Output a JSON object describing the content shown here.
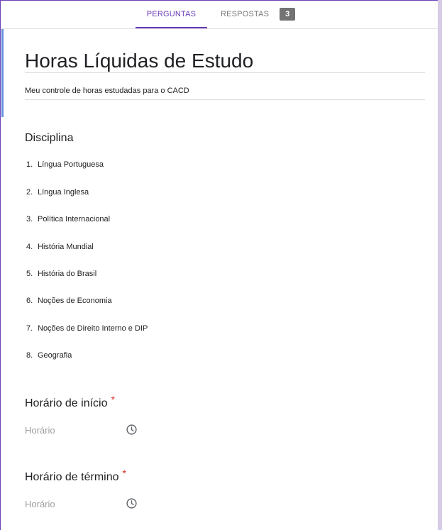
{
  "tabs": {
    "questions_label": "PERGUNTAS",
    "responses_label": "RESPOSTAS",
    "responses_count": "3"
  },
  "form": {
    "title": "Horas Líquidas de Estudo",
    "description": "Meu controle de horas estudadas para o CACD"
  },
  "questions": {
    "disciplina": {
      "title": "Disciplina",
      "options": [
        {
          "num": "1.",
          "label": "Língua Portuguesa"
        },
        {
          "num": "2.",
          "label": "Língua Inglesa"
        },
        {
          "num": "3.",
          "label": "Política Internacional"
        },
        {
          "num": "4.",
          "label": "História Mundial"
        },
        {
          "num": "5.",
          "label": "História do Brasil"
        },
        {
          "num": "6.",
          "label": "Noções de Economia"
        },
        {
          "num": "7.",
          "label": "Noções de Direito Interno e DIP"
        },
        {
          "num": "8.",
          "label": "Geografia"
        }
      ]
    },
    "inicio": {
      "title": "Horário de início",
      "required_mark": "*",
      "placeholder": "Horário",
      "icon": "clock-icon"
    },
    "termino": {
      "title": "Horário de término",
      "required_mark": "*",
      "placeholder": "Horário",
      "icon": "clock-icon"
    }
  },
  "colors": {
    "accent": "#673ab7",
    "required": "#d93025"
  }
}
